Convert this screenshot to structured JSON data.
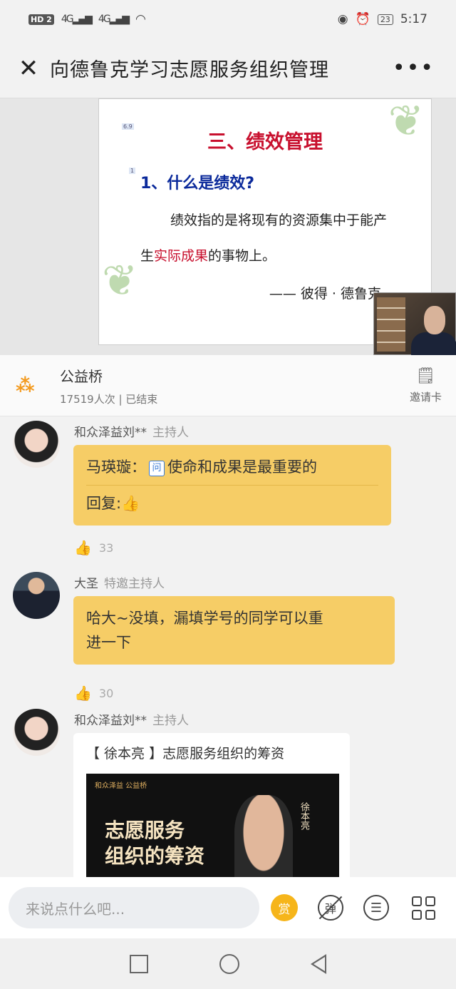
{
  "status": {
    "network": "HD 2",
    "signal1": "4G",
    "signal2": "4G",
    "battery": "23",
    "time": "5:17"
  },
  "titlebar": {
    "close_icon": "close-icon",
    "title": "向德鲁克学习志愿服务组织管理",
    "more_icon": "more-icon"
  },
  "slide": {
    "heading": "三、绩效管理",
    "subheading": "1、什么是绩效?",
    "line1": "绩效指的是将现有的资源集中于能产",
    "line2_pre": "生",
    "line2_red": "实际成果",
    "line2_post": "的事物上。",
    "quote": "—— 彼得 · 德鲁克"
  },
  "channel": {
    "name": "公益桥",
    "stats": "17519人次 | 已结束",
    "invite_label": "邀请卡"
  },
  "messages": [
    {
      "sender": "和众泽益刘**",
      "role": "主持人",
      "question": "马瑛璇：",
      "question_icon": "问",
      "question_text": "使命和成果是最重要的",
      "reply": "回复:",
      "reply_emoji": "👍",
      "likes": "33"
    },
    {
      "sender": "大圣",
      "role": "特邀主持人",
      "text_line1": "哈大~没填，漏填学号的同学可以重",
      "text_line2": "进一下",
      "likes": "30"
    },
    {
      "sender": "和众泽益刘**",
      "role": "主持人",
      "card_title": "【 徐本亮 】志愿服务组织的筹资",
      "card_brand": "和众泽益 公益桥",
      "card_big1": "志愿服务",
      "card_big2": "组织的筹资",
      "card_name": "徐本亮"
    }
  ],
  "inputbar": {
    "placeholder": "来说点什么吧...",
    "reward_label": "赏",
    "barrage_label": "弹",
    "comment_label": "☰"
  },
  "colors": {
    "bubble": "#f6cd66",
    "accent_orange": "#f39a1e",
    "slide_red": "#c8102e",
    "slide_blue": "#0b2a9b"
  }
}
